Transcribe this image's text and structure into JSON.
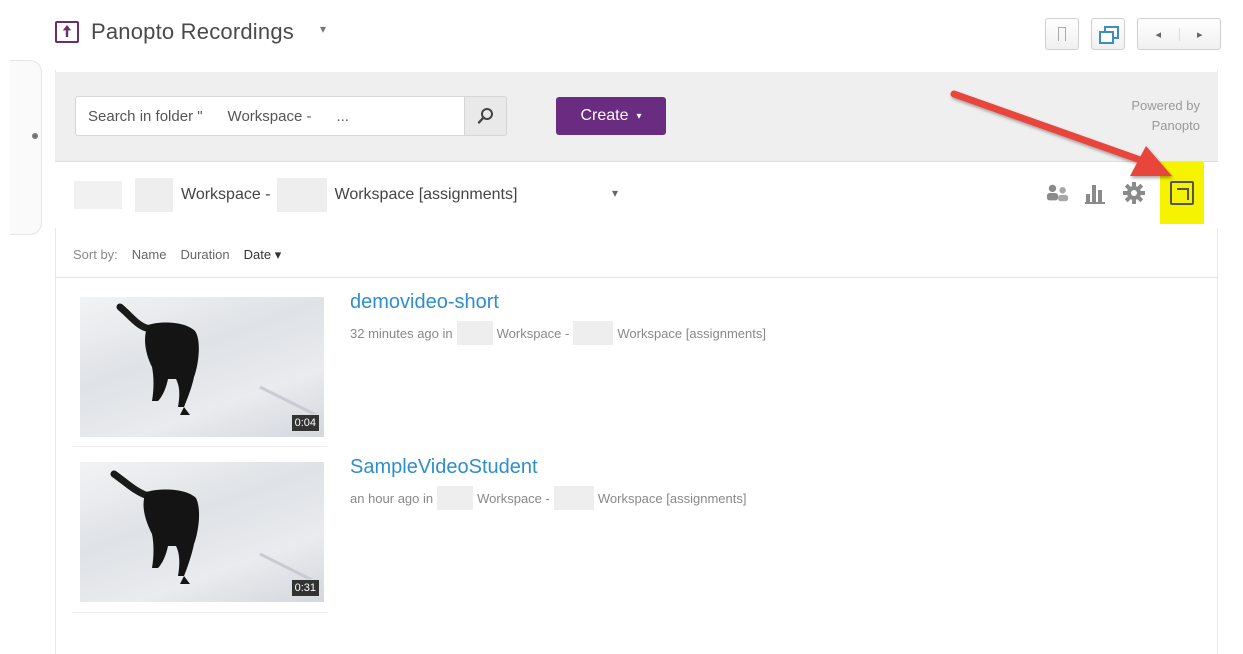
{
  "widget": {
    "title": "Panopto Recordings",
    "title_caret": "▾",
    "buttons": {
      "bookmark_icon": "bookmark-icon",
      "popout_icon": "restore-window-icon",
      "prev": "◂",
      "next": "▸"
    }
  },
  "toolbar": {
    "search_value": "Search in folder \"      Workspace -      ...",
    "create_label": "Create",
    "create_caret": "▾",
    "powered_line1": "Powered by",
    "powered_line2": "Panopto",
    "accent_color": "#6a2c81"
  },
  "folder": {
    "name_part1": "Workspace -",
    "name_part2": "Workspace [assignments]",
    "caret": "▾",
    "icons": [
      "users-icon",
      "stats-icon",
      "gear-icon",
      "popout-icon"
    ],
    "highlight_color": "#f6f300"
  },
  "sort": {
    "label": "Sort by:",
    "options": [
      "Name",
      "Duration",
      "Date ▾"
    ],
    "active": "Date"
  },
  "sessions": [
    {
      "title": "demovideo-short",
      "meta_prefix": "32 minutes ago in",
      "meta_part1": "Workspace -",
      "meta_part2": "Workspace [assignments]",
      "duration": "0:04"
    },
    {
      "title": "SampleVideoStudent",
      "meta_prefix": "an hour ago in",
      "meta_part1": "Workspace -",
      "meta_part2": "Workspace [assignments]",
      "duration": "0:31"
    }
  ],
  "annotation": {
    "arrow_color": "#e8453c"
  }
}
